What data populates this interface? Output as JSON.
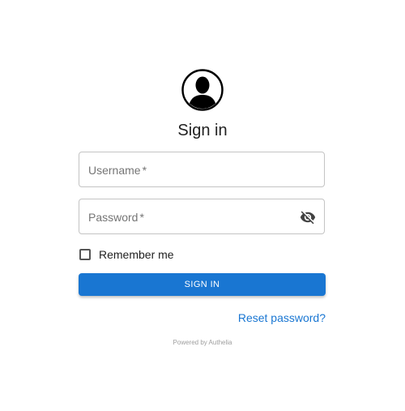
{
  "title": "Sign in",
  "username_field": {
    "label": "Username",
    "required_mark": "*",
    "value": ""
  },
  "password_field": {
    "label": "Password",
    "required_mark": "*",
    "value": "",
    "toggle_icon": "eye-off-icon"
  },
  "remember_me": {
    "label": "Remember me",
    "checked": false
  },
  "signin_button": {
    "label": "SIGN IN"
  },
  "reset_link": {
    "label": "Reset password?"
  },
  "footer": {
    "powered_by": "Powered by Authelia"
  },
  "colors": {
    "accent": "#1976d2",
    "border": "#c4c4c4",
    "label": "#757575",
    "text": "#212121"
  }
}
